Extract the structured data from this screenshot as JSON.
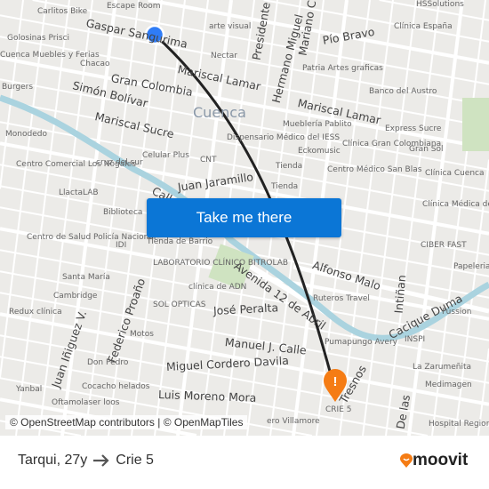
{
  "map": {
    "city_label": "Cuenca",
    "streets": [
      "Gaspar Sangurima",
      "Gran Colombia",
      "Simón Bolívar",
      "Mariscal Sucre",
      "Mariscal Lamar",
      "Mariscal Lamar",
      "Juan Jaramillo",
      "Calle Larga",
      "Avenida 12 de Abril",
      "Alfonso Malo",
      "José Peralta",
      "Manuel J. Calle",
      "Miguel Cordero Davila",
      "Luis Moreno Mora",
      "Pío Bravo",
      "Presidente",
      "Hermano Miguel",
      "Mariano C",
      "Cacique Duma",
      "Federico Proaño",
      "Juan Iñiguez V.",
      "Intiñan",
      "Tresnos",
      "De las"
    ],
    "places": [
      "Escape Room",
      "Carlitos Bike",
      "Golosinas Prisci",
      "Cuenca Muebles y Ferias",
      "Chacao",
      "Burgers",
      "Monodedo",
      "Centro Comercial Los Nogales",
      "cruz del sur",
      "LlactaLAB",
      "Celular Plus",
      "CNT",
      "arte visual",
      "Nectar",
      "Patria Artes graficas",
      "Clínica España",
      "HSSolutions",
      "Banco del Austro",
      "Mueblería Pablito",
      "Dispensario Médico del IESS",
      "Eckomusic",
      "Clínica Gran Colombiana",
      "Express Sucre",
      "Gran Sol",
      "Tienda",
      "Tienda",
      "Centro Médico San Blas",
      "Clínica Cuenca",
      "Biblioteca",
      "Centro de Salud Policía Nacional",
      "Tienda de Barrio",
      "IDI",
      "LABORATORIO CLÍNICO BITROLAB",
      "clínica de ADN",
      "SOL OPTICAS",
      "Santa María",
      "Cambridge",
      "Redux clínica",
      "Ruteros Travel",
      "Pumapungo Avery",
      "INSPI",
      "CIBER FAST",
      "Fussion",
      "La Zarumeñita",
      "Medimagen",
      "Motos",
      "Don Pedro",
      "Cocacho helados",
      "Yanbal",
      "Oftamolaser loos",
      "CRIE 5",
      "ero Villamore",
      "Hospital Regional Vicente Corral",
      "Clínica Médica del Sur",
      "Papeleria Y B"
    ],
    "attribution": "© OpenStreetMap contributors | © OpenMapTiles",
    "start_marker": {
      "icon": "origin-dot-icon",
      "color": "#2f7cf6"
    },
    "end_marker": {
      "icon": "destination-pin-icon",
      "color": "#f57c14"
    },
    "route_color": "#222222",
    "river_color": "#aad3df",
    "park_color": "#cfe3c1"
  },
  "cta": {
    "label": "Take me there",
    "color": "#0b76d6"
  },
  "footer": {
    "origin": "Tarqui, 27y",
    "arrow_icon": "arrow-right-icon",
    "destination": "Crie 5",
    "logo": "moovit",
    "logo_color": "#f57c14"
  }
}
